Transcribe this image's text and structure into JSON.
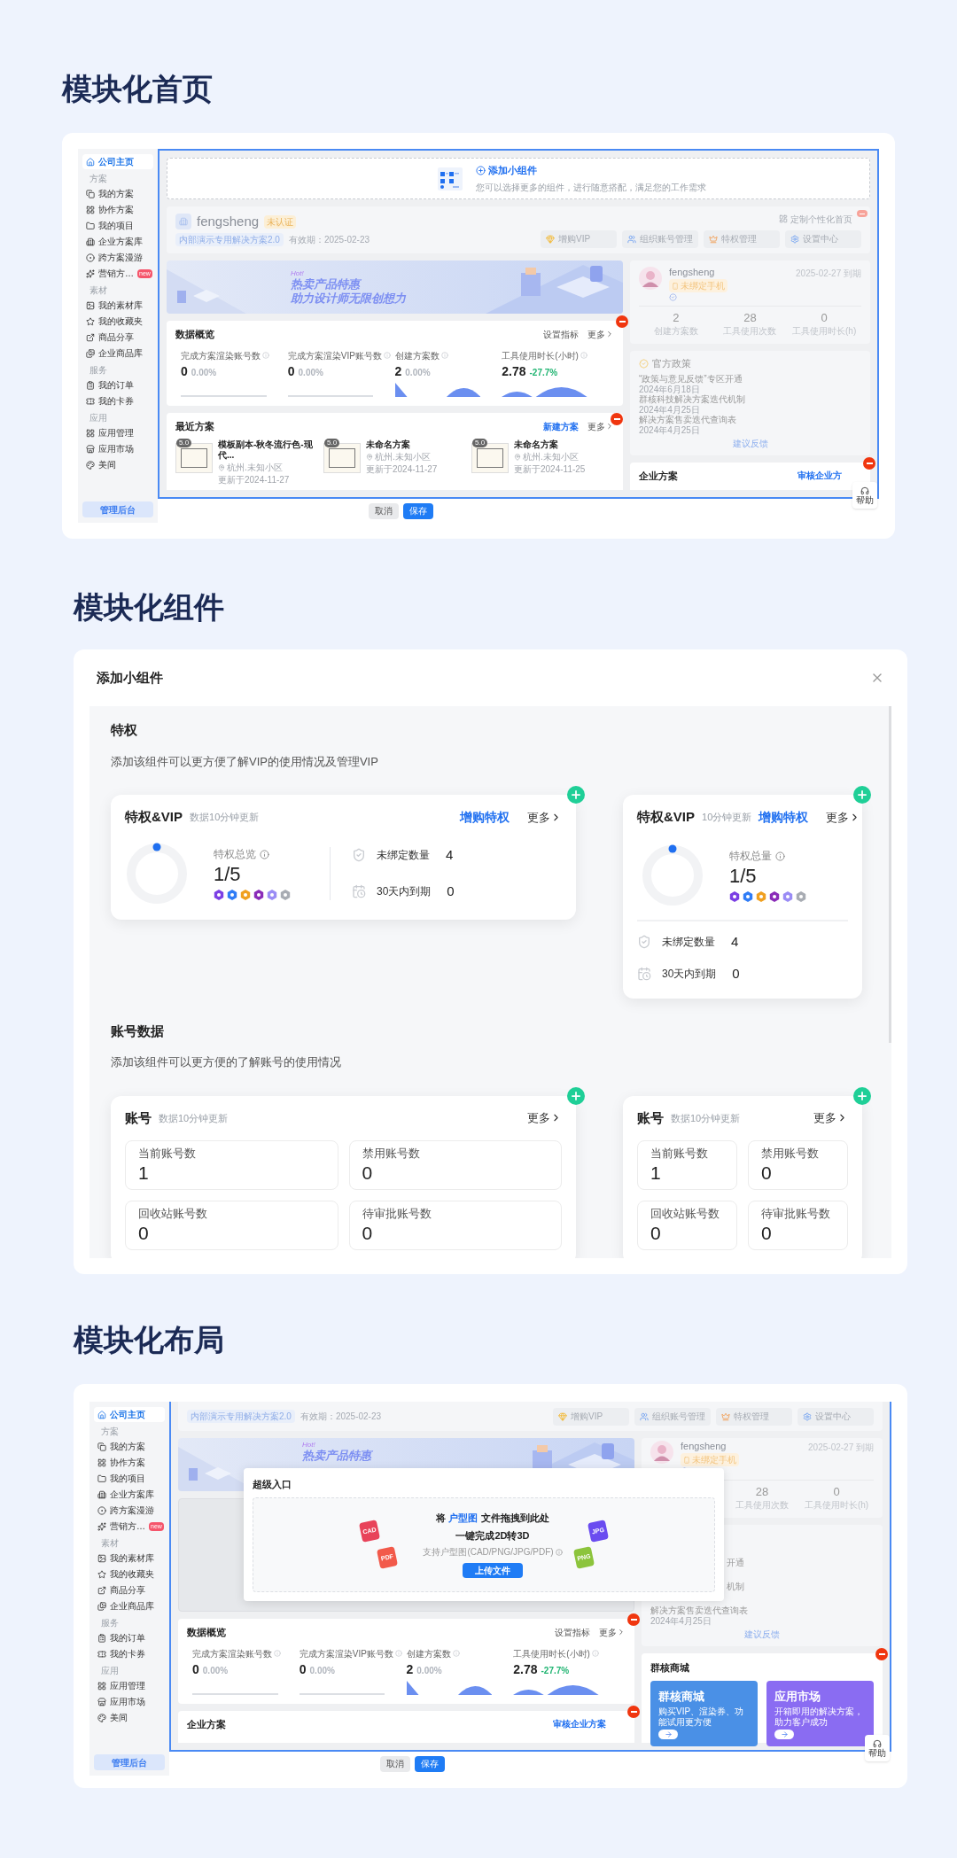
{
  "home": {
    "title": "模块化首页",
    "sidebar": {
      "items": [
        {
          "kind": "item",
          "label": "公司主页",
          "selected": true
        },
        {
          "kind": "header",
          "label": "方案"
        },
        {
          "kind": "item",
          "label": "我的方案",
          "selected": false
        },
        {
          "kind": "item",
          "label": "协作方案",
          "selected": false
        },
        {
          "kind": "item",
          "label": "我的项目",
          "selected": false
        },
        {
          "kind": "item",
          "label": "企业方案库",
          "selected": false
        },
        {
          "kind": "item",
          "label": "跨方案漫游",
          "selected": false
        },
        {
          "kind": "item",
          "label": "营销方…",
          "selected": false,
          "badge": "new"
        },
        {
          "kind": "header",
          "label": "素材"
        },
        {
          "kind": "item",
          "label": "我的素材库",
          "selected": false
        },
        {
          "kind": "item",
          "label": "我的收藏夹",
          "selected": false
        },
        {
          "kind": "item",
          "label": "商品分享",
          "selected": false
        },
        {
          "kind": "item",
          "label": "企业商品库",
          "selected": false
        },
        {
          "kind": "header",
          "label": "服务"
        },
        {
          "kind": "item",
          "label": "我的订单",
          "selected": false
        },
        {
          "kind": "item",
          "label": "我的卡券",
          "selected": false
        },
        {
          "kind": "header",
          "label": "应用"
        },
        {
          "kind": "item",
          "label": "应用管理",
          "selected": false
        },
        {
          "kind": "item",
          "label": "应用市场",
          "selected": false
        },
        {
          "kind": "item",
          "label": "美间",
          "selected": false
        }
      ],
      "admin_button": "管理后台"
    },
    "add_widget": {
      "title": "添加小组件",
      "description": "您可以选择更多的组件，进行随意搭配，满足您的工作需求"
    },
    "profile": {
      "name": "fengsheng",
      "status": "未认证",
      "plan": "内部演示专用解决方案2.0",
      "validity": "有效期：2025-02-23",
      "customize": "定制个性化首页",
      "quick": [
        "增购VIP",
        "组织账号管理",
        "特权管理",
        "设置中心"
      ]
    },
    "banner": {
      "hot": "Hot!",
      "lines": [
        "热卖产品特惠",
        "助力设计师无限创想力"
      ]
    },
    "data_overview": {
      "title": "数据概览",
      "setting": "设置指标",
      "more": "更多",
      "metrics": [
        {
          "label": "完成方案渲染账号数",
          "value": "0",
          "change": "0.00%",
          "color": "#b0b5bd",
          "kind": "line"
        },
        {
          "label": "完成方案渲染VIP账号数",
          "value": "0",
          "change": "0.00%",
          "color": "#b0b5bd",
          "kind": "line"
        },
        {
          "label": "创建方案数",
          "value": "2",
          "change": "0.00%",
          "color": "#b0b5bd",
          "kind": "peaks"
        },
        {
          "label": "工具使用时长(小时)",
          "value": "2.78",
          "change": "-27.7%",
          "color": "#22b573",
          "kind": "hills"
        }
      ]
    },
    "recent": {
      "title": "最近方案",
      "action": "新建方案",
      "more": "更多",
      "items": [
        {
          "name": "模板副本-秋冬流行色-现代...",
          "location": "杭州.未知小区",
          "updated": "更新于2024-11-27",
          "version": "5.0"
        },
        {
          "name": "未命名方案",
          "location": "杭州.未知小区",
          "updated": "更新于2024-11-27",
          "version": "5.0"
        },
        {
          "name": "未命名方案",
          "location": "杭州.未知小区",
          "updated": "更新于2024-11-25",
          "version": "5.0"
        }
      ]
    },
    "user_card": {
      "name": "fengsheng",
      "phone_badge": "未绑定手机",
      "expiry": "2025-02-27 到期",
      "stats": [
        {
          "value": "2",
          "label": "创建方案数"
        },
        {
          "value": "28",
          "label": "工具使用次数"
        },
        {
          "value": "0",
          "label": "工具使用时长(h)"
        }
      ]
    },
    "policy": {
      "title": "官方政策",
      "items": [
        {
          "title": "“政策与意见反馈”专区开通",
          "date": "2024年6月18日"
        },
        {
          "title": "群核科技解决方案迭代机制",
          "date": "2024年4月25日"
        },
        {
          "title": "解决方案售卖迭代查询表",
          "date": "2024年4月25日"
        }
      ],
      "link": "建议反馈"
    },
    "enterprise": {
      "title": "企业方案",
      "action": "审核企业方"
    },
    "help": "帮助",
    "footer_buttons": [
      "取消",
      "保存"
    ]
  },
  "widgets": {
    "title": "模块化组件",
    "dialog_title": "添加小组件",
    "groups": [
      {
        "kind": "privilege",
        "heading": "特权",
        "description": "添加该组件可以更方便了解VIP的使用情况及管理VIP",
        "cards": [
          {
            "kind": "wide",
            "title": "特权&VIP",
            "note": "数据10分钟更新",
            "action": "增购特权",
            "more": "更多",
            "total_label": "特权总览",
            "total": "1/5",
            "rows": [
              {
                "label": "未绑定数量",
                "value": "4"
              },
              {
                "label": "30天内到期",
                "value": "0"
              }
            ]
          },
          {
            "kind": "narrow",
            "title": "特权&VIP",
            "note": "10分钟更新",
            "action": "增购特权",
            "more": "更多",
            "total_label": "特权总量",
            "total": "1/5",
            "rows": [
              {
                "label": "未绑定数量",
                "value": "4"
              },
              {
                "label": "30天内到期",
                "value": "0"
              }
            ]
          }
        ]
      },
      {
        "kind": "accounts",
        "heading": "账号数据",
        "description": "添加该组件可以更方便的了解账号的使用情况",
        "cards": [
          {
            "kind": "wide",
            "title": "账号",
            "note": "数据10分钟更新",
            "more": "更多",
            "tiles": [
              {
                "label": "当前账号数",
                "value": "1"
              },
              {
                "label": "禁用账号数",
                "value": "0"
              },
              {
                "label": "回收站账号数",
                "value": "0"
              },
              {
                "label": "待审批账号数",
                "value": "0"
              }
            ]
          },
          {
            "kind": "narrow",
            "title": "账号",
            "note": "数据10分钟更新",
            "more": "更多",
            "tiles": [
              {
                "label": "当前账号数",
                "value": "1"
              },
              {
                "label": "禁用账号数",
                "value": "0"
              },
              {
                "label": "回收站账号数",
                "value": "0"
              },
              {
                "label": "待审批账号数",
                "value": "0"
              }
            ]
          }
        ]
      }
    ]
  },
  "layout": {
    "title": "模块化布局",
    "sidebar": {
      "items": [
        {
          "kind": "item",
          "label": "公司主页",
          "selected": true
        },
        {
          "kind": "header",
          "label": "方案"
        },
        {
          "kind": "item",
          "label": "我的方案",
          "selected": false
        },
        {
          "kind": "item",
          "label": "协作方案",
          "selected": false
        },
        {
          "kind": "item",
          "label": "我的项目",
          "selected": false
        },
        {
          "kind": "item",
          "label": "企业方案库",
          "selected": false
        },
        {
          "kind": "item",
          "label": "跨方案漫游",
          "selected": false
        },
        {
          "kind": "item",
          "label": "营销方…",
          "selected": false,
          "badge": "new"
        },
        {
          "kind": "header",
          "label": "素材"
        },
        {
          "kind": "item",
          "label": "我的素材库",
          "selected": false
        },
        {
          "kind": "item",
          "label": "我的收藏夹",
          "selected": false
        },
        {
          "kind": "item",
          "label": "商品分享",
          "selected": false
        },
        {
          "kind": "item",
          "label": "企业商品库",
          "selected": false
        },
        {
          "kind": "header",
          "label": "服务"
        },
        {
          "kind": "item",
          "label": "我的订单",
          "selected": false
        },
        {
          "kind": "item",
          "label": "我的卡券",
          "selected": false
        },
        {
          "kind": "header",
          "label": "应用"
        },
        {
          "kind": "item",
          "label": "应用管理",
          "selected": false
        },
        {
          "kind": "item",
          "label": "应用市场",
          "selected": false
        },
        {
          "kind": "item",
          "label": "美间",
          "selected": false
        }
      ],
      "admin_button": "管理后台"
    },
    "profile": {
      "plan": "内部演示专用解决方案2.0",
      "validity": "有效期：2025-02-23",
      "quick": [
        "增购VIP",
        "组织账号管理",
        "特权管理",
        "设置中心"
      ]
    },
    "banner": {
      "hot": "Hot!",
      "lines": [
        "热卖产品特惠"
      ]
    },
    "modal": {
      "title": "超级入口",
      "drop_before": "将",
      "drop_highlight": "户型图",
      "drop_after": "文件拖拽到此处",
      "subtitle": "一键完成2D转3D",
      "hint": "支持户型图(CAD/PNG/JPG/PDF)",
      "button": "上传文件",
      "files_left": [
        {
          "label": "CAD",
          "color": "#e8435a"
        },
        {
          "label": "PDF",
          "color": "#f25a4a"
        }
      ],
      "files_right": [
        {
          "label": "JPG",
          "color": "#6a4cf0"
        },
        {
          "label": "PNG",
          "color": "#8cc43c"
        }
      ]
    },
    "data_overview": {
      "title": "数据概览",
      "setting": "设置指标",
      "more": "更多",
      "metrics": [
        {
          "label": "完成方案渲染账号数",
          "value": "0",
          "change": "0.00%",
          "color": "#b0b5bd",
          "kind": "line"
        },
        {
          "label": "完成方案渲染VIP账号数",
          "value": "0",
          "change": "0.00%",
          "color": "#b0b5bd",
          "kind": "line"
        },
        {
          "label": "创建方案数",
          "value": "2",
          "change": "0.00%",
          "color": "#b0b5bd",
          "kind": "peaks"
        },
        {
          "label": "工具使用时长(小时)",
          "value": "2.78",
          "change": "-27.7%",
          "color": "#22b573",
          "kind": "hills"
        }
      ]
    },
    "enterprise": {
      "title": "企业方案",
      "action": "审核企业方案"
    },
    "user_card": {
      "name": "fengsheng",
      "phone_badge": "未绑定手机",
      "expiry": "2025-02-27 到期",
      "stats": [
        {
          "value": "28",
          "label": "工具使用次数"
        },
        {
          "value": "0",
          "label": "工具使用时长(h)"
        }
      ]
    },
    "policy": {
      "items": [
        {
          "title": "开通",
          "kind": "fragment"
        },
        {
          "title": "机制",
          "kind": "fragment"
        },
        {
          "title": "解决方案售卖迭代查询表",
          "date": "2024年4月25日",
          "kind": "full"
        }
      ],
      "link": "建议反馈"
    },
    "mall": {
      "title": "群核商城",
      "tiles": [
        {
          "title": "群核商城",
          "description": "购买VIP、渲染券、功能试用更方便",
          "color": "#4a90e6"
        },
        {
          "title": "应用市场",
          "description": "开箱即用的解决方案，助力客户成功",
          "color": "#8a6cf2"
        }
      ]
    },
    "help": "帮助",
    "footer_buttons": [
      "取消",
      "保存"
    ]
  }
}
